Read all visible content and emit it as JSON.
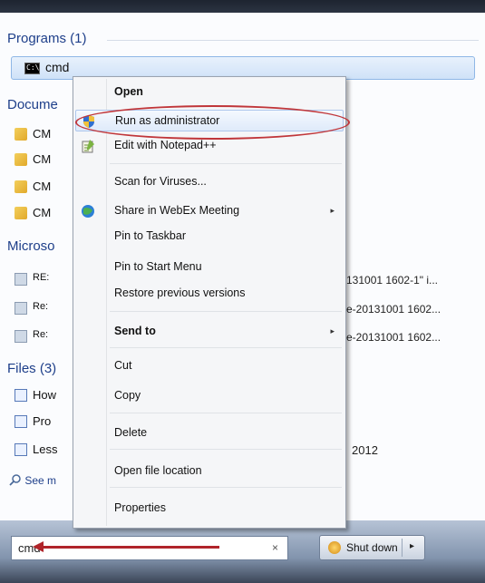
{
  "start_menu": {
    "groups": {
      "programs": "Programs (1)",
      "documents": "Docume",
      "microsoft": "Microso",
      "files": "Files (3)"
    },
    "program_item": "cmd",
    "document_items": [
      "CM",
      "CM",
      "CM",
      "CM"
    ],
    "microsoft_items": [
      {
        "left": "RE:",
        "right": "131001 1602-1\" i..."
      },
      {
        "left": "Re:",
        "right": "e-20131001 1602..."
      },
      {
        "left": "Re:",
        "right": "e-20131001 1602..."
      }
    ],
    "file_items": [
      {
        "left": "How",
        "right": ""
      },
      {
        "left": "Pro",
        "right": ""
      },
      {
        "left": "Less",
        "right": "2012"
      }
    ],
    "see_more": "See m",
    "search_value": "cmd",
    "search_clear": "×",
    "shutdown_label": "Shut down",
    "shutdown_arrow": "▸"
  },
  "context_menu": {
    "items": [
      {
        "label": "Open",
        "bold": true
      },
      {
        "label": "Run as administrator",
        "highlighted": true
      },
      {
        "label": "Edit with Notepad++"
      },
      {
        "label": "Scan for Viruses..."
      },
      {
        "label": "Share in WebEx Meeting",
        "submenu": "▸"
      },
      {
        "label": "Pin to Taskbar"
      },
      {
        "label": "Pin to Start Menu"
      },
      {
        "label": "Restore previous versions"
      },
      {
        "label": "Send to",
        "submenu": "▸"
      },
      {
        "label": "Cut"
      },
      {
        "label": "Copy"
      },
      {
        "label": "Delete"
      },
      {
        "label": "Open file location"
      },
      {
        "label": "Properties"
      }
    ]
  },
  "colors": {
    "annotation": "#c0363a",
    "group_heading": "#1e3f8a"
  },
  "icons": [
    "cmd-icon",
    "folder-icon",
    "mail-icon",
    "document-icon",
    "search-icon",
    "shield-icon",
    "notepad-icon",
    "webex-icon",
    "shutdown-icon"
  ]
}
